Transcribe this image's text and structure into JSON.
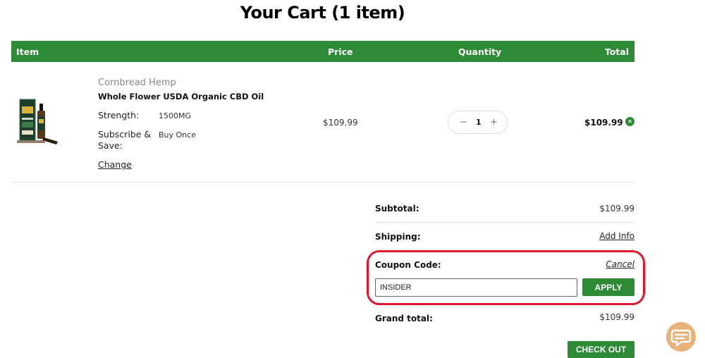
{
  "page": {
    "title": "Your Cart (1 item)"
  },
  "table_header": {
    "item": "Item",
    "price": "Price",
    "quantity": "Quantity",
    "total": "Total"
  },
  "cart_item": {
    "brand": "Cornbread Hemp",
    "name": "Whole Flower USDA Organic CBD Oil",
    "options": [
      {
        "label": "Strength:",
        "value": "1500MG"
      },
      {
        "label": "Subscribe & Save:",
        "value": "Buy Once"
      }
    ],
    "change_label": "Change",
    "unit_price": "$109.99",
    "quantity": "1",
    "line_total": "$109.99",
    "image_icon": "cbd-oil-product-icon"
  },
  "summary": {
    "subtotal_label": "Subtotal:",
    "subtotal_value": "$109.99",
    "shipping_label": "Shipping:",
    "shipping_action": "Add Info",
    "coupon_label": "Coupon Code:",
    "coupon_cancel": "Cancel",
    "coupon_value": "INSIDER",
    "apply_label": "APPLY",
    "grand_total_label": "Grand total:",
    "grand_total_value": "$109.99",
    "checkout_label": "CHECK OUT"
  },
  "colors": {
    "brand_green": "#2e8b35",
    "highlight_red": "#e0182d",
    "chat_orange": "#e8b37a"
  },
  "icons": {
    "minus": "minus-icon",
    "plus": "plus-icon",
    "remove": "remove-icon",
    "chat": "chat-icon"
  }
}
